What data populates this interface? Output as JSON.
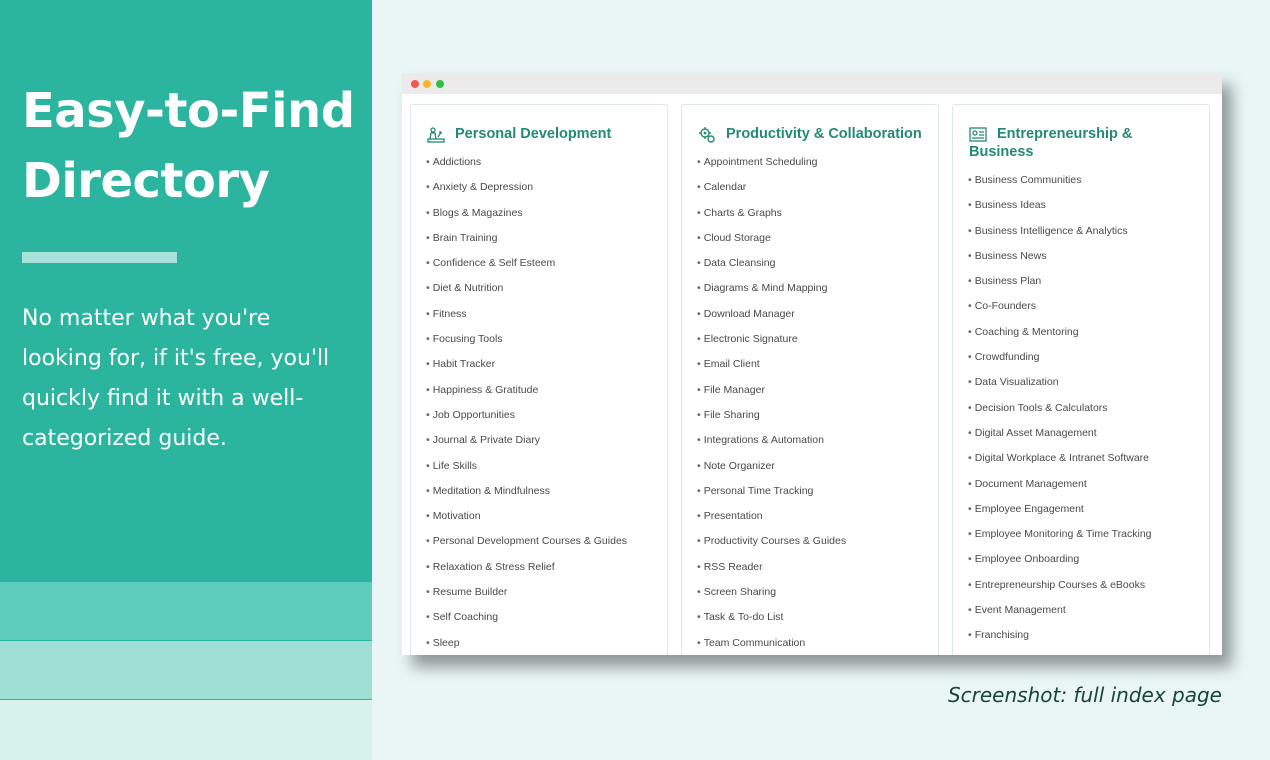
{
  "hero": {
    "headline_line1": "Easy-to-Find",
    "headline_line2": "Directory",
    "description": "No matter what you're looking for, if it's free, you'll quickly find it with a well-categorized guide."
  },
  "caption": "Screenshot: full index page",
  "colors": {
    "panel": "#2bb59f",
    "background": "#e9f6f5",
    "category_title": "#238a74"
  },
  "window": {
    "controls": [
      "close",
      "minimize",
      "maximize"
    ],
    "columns": [
      {
        "icon": "person-growth-icon",
        "title": "Personal Development",
        "items": [
          "Addictions",
          "Anxiety & Depression",
          "Blogs & Magazines",
          "Brain Training",
          "Confidence & Self Esteem",
          "Diet & Nutrition",
          "Fitness",
          "Focusing Tools",
          "Habit Tracker",
          "Happiness & Gratitude",
          "Job Opportunities",
          "Journal & Private Diary",
          "Life Skills",
          "Meditation & Mindfulness",
          "Motivation",
          "Personal Development Courses & Guides",
          "Relaxation & Stress Relief",
          "Resume Builder",
          "Self Coaching",
          "Sleep"
        ]
      },
      {
        "icon": "gears-icon",
        "title": "Productivity & Collaboration",
        "items": [
          "Appointment Scheduling",
          "Calendar",
          "Charts & Graphs",
          "Cloud Storage",
          "Data Cleansing",
          "Diagrams & Mind Mapping",
          "Download Manager",
          "Electronic Signature",
          "Email Client",
          "File Manager",
          "File Sharing",
          "Integrations & Automation",
          "Note Organizer",
          "Personal Time Tracking",
          "Presentation",
          "Productivity Courses & Guides",
          "RSS Reader",
          "Screen Sharing",
          "Task & To-do List",
          "Team Communication"
        ]
      },
      {
        "icon": "business-dashboard-icon",
        "title_line1": "Entrepreneurship &",
        "title_line2": "Business",
        "items": [
          "Business Communities",
          "Business Ideas",
          "Business Intelligence & Analytics",
          "Business News",
          "Business Plan",
          "Co-Founders",
          "Coaching & Mentoring",
          "Crowdfunding",
          "Data Visualization",
          "Decision Tools & Calculators",
          "Digital Asset Management",
          "Digital Workplace & Intranet Software",
          "Document Management",
          "Employee Engagement",
          "Employee Monitoring & Time Tracking",
          "Employee Onboarding",
          "Entrepreneurship Courses & eBooks",
          "Event Management",
          "Franchising"
        ]
      }
    ]
  }
}
